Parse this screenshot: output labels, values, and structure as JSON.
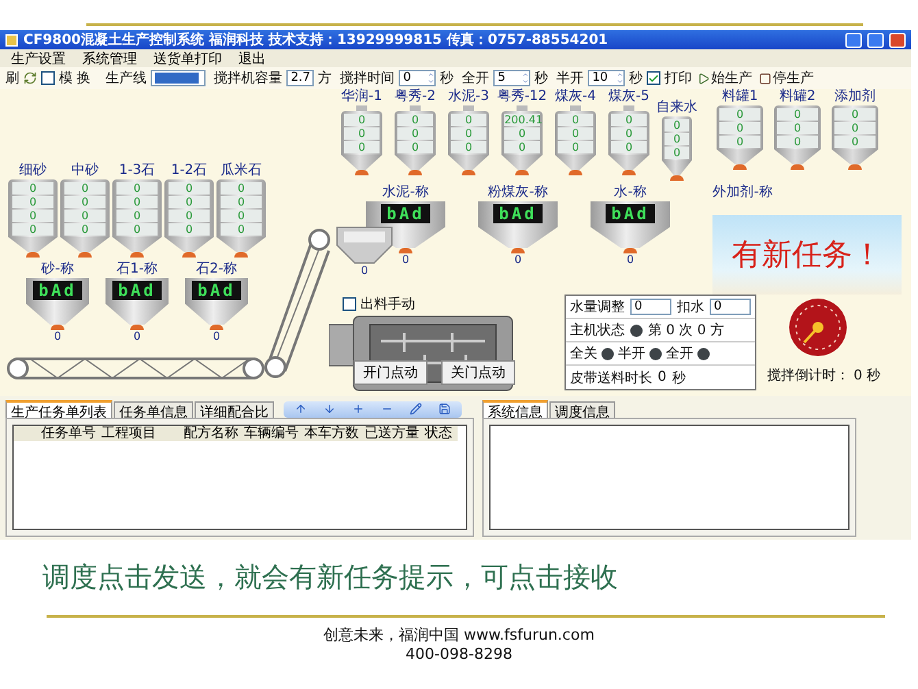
{
  "window": {
    "title": "CF9800混凝土生产控制系统  福润科技  技术支持：13929999815   传真：0757-88554201"
  },
  "menu": [
    "生产设置",
    "系统管理",
    "送货单打印",
    "退出"
  ],
  "toolbar": {
    "refresh_label": "刷",
    "swap_checkbox": {
      "label": "模  换",
      "checked": false
    },
    "line_label": "生产线",
    "fields": [
      {
        "label": "搅拌机容量",
        "value": "2.7",
        "unit": "方",
        "kind": "text"
      },
      {
        "label": "搅拌时间",
        "value": "0",
        "unit": "秒",
        "kind": "spin"
      },
      {
        "label": "全开",
        "value": "5",
        "unit": "秒",
        "kind": "spin"
      },
      {
        "label": "半开",
        "value": "10",
        "unit": "秒",
        "kind": "spin"
      }
    ],
    "print_checkbox": {
      "label": "打印",
      "checked": true
    },
    "buttons": [
      "始生产",
      "停生产"
    ]
  },
  "aggregate_bins": [
    {
      "label": "细砂",
      "readings": [
        "0",
        "0",
        "0",
        "0"
      ]
    },
    {
      "label": "中砂",
      "readings": [
        "0",
        "0",
        "0",
        "0"
      ]
    },
    {
      "label": "1-3石",
      "readings": [
        "0",
        "0",
        "0",
        "0"
      ]
    },
    {
      "label": "1-2石",
      "readings": [
        "0",
        "0",
        "0",
        "0"
      ]
    },
    {
      "label": "瓜米石",
      "readings": [
        "0",
        "0",
        "0",
        "0"
      ]
    }
  ],
  "aggregate_scales": [
    {
      "label": "砂-称",
      "display": "bAd",
      "reading": "0"
    },
    {
      "label": "石1-称",
      "display": "bAd",
      "reading": "0"
    },
    {
      "label": "石2-称",
      "display": "bAd",
      "reading": "0"
    }
  ],
  "powder_silos": [
    {
      "label": "华润-1",
      "readings": [
        "0",
        "0",
        "0"
      ]
    },
    {
      "label": "粤秀-2",
      "readings": [
        "0",
        "0",
        "0"
      ]
    },
    {
      "label": "水泥-3",
      "readings": [
        "0",
        "0",
        "0"
      ]
    },
    {
      "label": "粤秀-12",
      "readings": [
        "200.41",
        "0",
        "0"
      ]
    },
    {
      "label": "煤灰-4",
      "readings": [
        "0",
        "0",
        "0"
      ]
    },
    {
      "label": "煤灰-5",
      "readings": [
        "0",
        "0",
        "0"
      ]
    }
  ],
  "water_tank": {
    "label": "自来水",
    "readings": [
      "0",
      "0",
      "0"
    ]
  },
  "additive_tanks": [
    {
      "label": "料罐1",
      "readings": [
        "0",
        "0",
        "0"
      ]
    },
    {
      "label": "料罐2",
      "readings": [
        "0",
        "0",
        "0"
      ]
    },
    {
      "label": "添加剂",
      "readings": [
        "0",
        "0",
        "0"
      ]
    }
  ],
  "scales": [
    {
      "label": "水泥-称",
      "display": "bAd",
      "reading": "0"
    },
    {
      "label": "粉煤灰-称",
      "display": "bAd",
      "reading": "0"
    },
    {
      "label": "水-称",
      "display": "bAd",
      "reading": "0"
    },
    {
      "label": "外加剂-称"
    }
  ],
  "feed_hopper": {
    "reading": "0"
  },
  "discharge_manual": {
    "label": "出料手动",
    "checked": false
  },
  "mixer_buttons": [
    "开门点动",
    "关门点动"
  ],
  "notice": {
    "text": "有新任务！"
  },
  "control_panel": {
    "water_adjust": {
      "label": "水量调整",
      "value": "0"
    },
    "deduct_water": {
      "label": "扣水",
      "value": "0"
    },
    "host_status": {
      "label": "主机状态",
      "on": false
    },
    "batch": "第 0 次 0 方",
    "doors": [
      {
        "label": "全关",
        "on": false
      },
      {
        "label": "半开",
        "on": false
      },
      {
        "label": "全开",
        "on": false
      }
    ],
    "belt": {
      "label": "皮带送料时长",
      "value": "0",
      "unit": "秒"
    }
  },
  "countdown": {
    "label": "搅拌倒计时：",
    "value": "0",
    "unit": "秒"
  },
  "left_panel": {
    "tabs": [
      {
        "label": "生产任务单列表",
        "selected": true
      },
      {
        "label": "任务单信息",
        "selected": false
      },
      {
        "label": "详细配合比",
        "selected": false
      }
    ],
    "columns": [
      "任务单号",
      "工程项目",
      "配方名称",
      "车辆编号",
      "本车方数",
      "已送方量",
      "状态"
    ]
  },
  "right_panel": {
    "tabs": [
      {
        "label": "系统信息",
        "selected": true
      },
      {
        "label": "调度信息",
        "selected": false
      }
    ]
  },
  "caption": "调度点击发送，就会有新任务提示，可点击接收",
  "footer": {
    "slogan": "创意未来，福润中国  www.fsfurun.com",
    "phone": "400-098-8298"
  }
}
